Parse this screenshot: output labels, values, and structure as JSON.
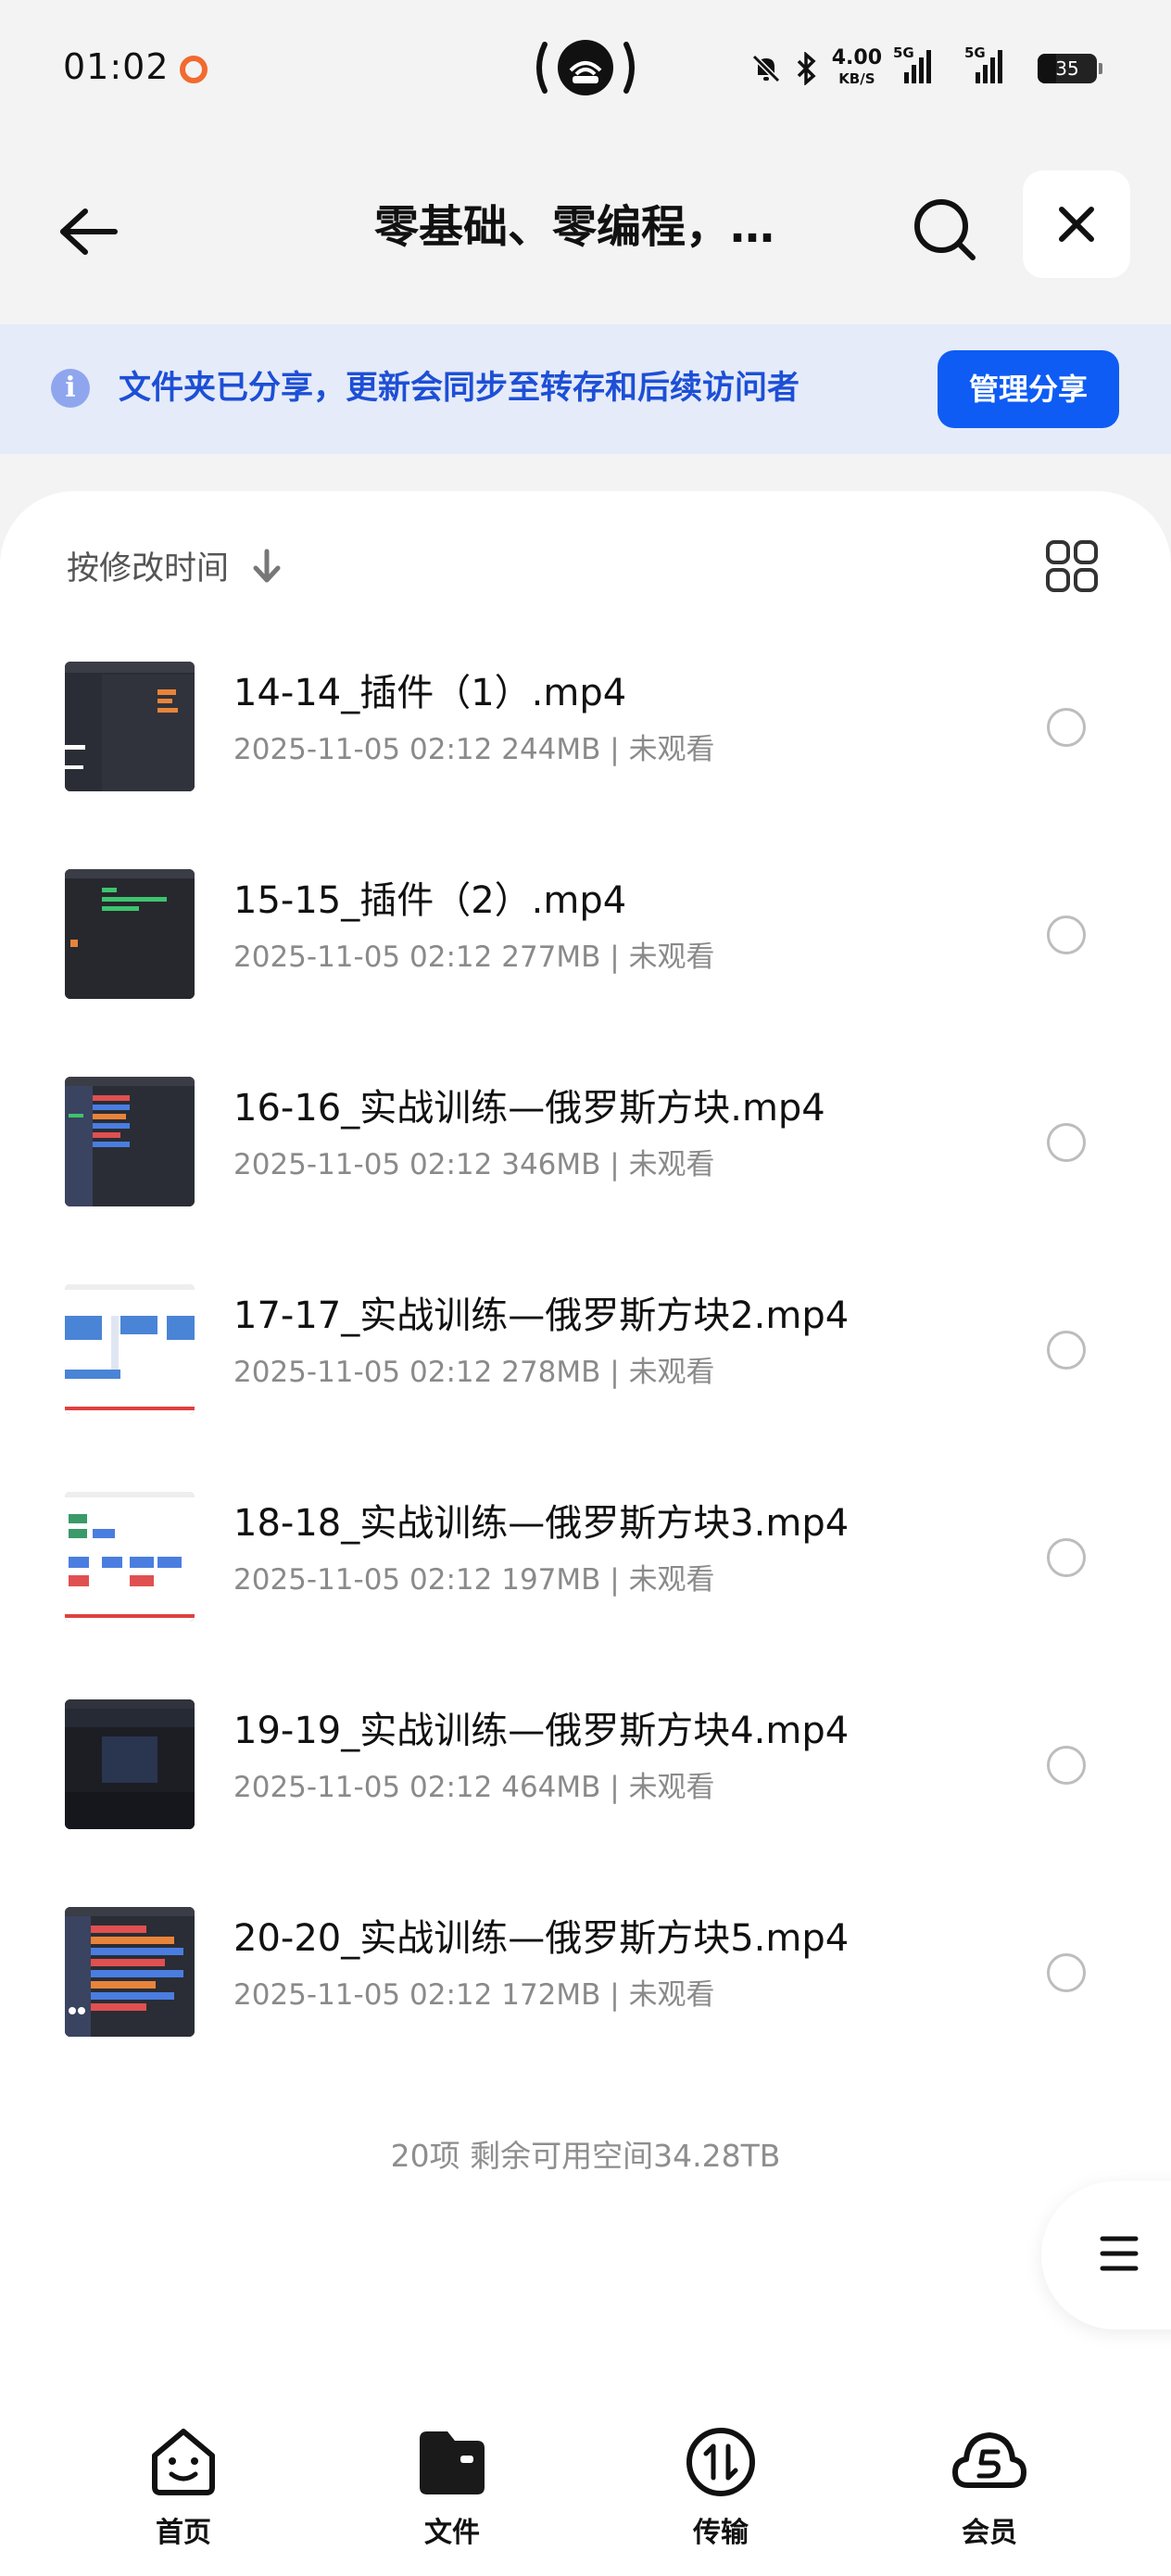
{
  "status_bar": {
    "time": "01:02",
    "net_speed": "4.00",
    "net_speed_unit": "KB/S",
    "sim1": "5G",
    "sim2": "5G",
    "battery": "35"
  },
  "header": {
    "title": "零基础、零编程，…"
  },
  "share_banner": {
    "message": "文件夹已分享，更新会同步至转存和后续访问者",
    "button": "管理分享"
  },
  "sort": {
    "label": "按修改时间"
  },
  "files": [
    {
      "name": "14-14_插件（1）.mp4",
      "date": "2025-11-05 02:12",
      "size": "244MB",
      "status": "未观看"
    },
    {
      "name": "15-15_插件（2）.mp4",
      "date": "2025-11-05 02:12",
      "size": "277MB",
      "status": "未观看"
    },
    {
      "name": "16-16_实战训练—俄罗斯方块.mp4",
      "date": "2025-11-05 02:12",
      "size": "346MB",
      "status": "未观看"
    },
    {
      "name": "17-17_实战训练—俄罗斯方块2.mp4",
      "date": "2025-11-05 02:12",
      "size": "278MB",
      "status": "未观看"
    },
    {
      "name": "18-18_实战训练—俄罗斯方块3.mp4",
      "date": "2025-11-05 02:12",
      "size": "197MB",
      "status": "未观看"
    },
    {
      "name": "19-19_实战训练—俄罗斯方块4.mp4",
      "date": "2025-11-05 02:12",
      "size": "464MB",
      "status": "未观看"
    },
    {
      "name": "20-20_实战训练—俄罗斯方块5.mp4",
      "date": "2025-11-05 02:12",
      "size": "172MB",
      "status": "未观看"
    }
  ],
  "footer_note": "20项 剩余可用空间34.28TB",
  "bottom_nav": [
    {
      "label": "首页",
      "icon": "home-face-icon"
    },
    {
      "label": "文件",
      "icon": "folder-icon"
    },
    {
      "label": "传输",
      "icon": "transfer-icon"
    },
    {
      "label": "会员",
      "icon": "vip-cloud-icon"
    }
  ],
  "colors": {
    "accent": "#0e5cf4",
    "banner_bg": "#e5ebf8",
    "banner_text": "#1d4fd6"
  }
}
